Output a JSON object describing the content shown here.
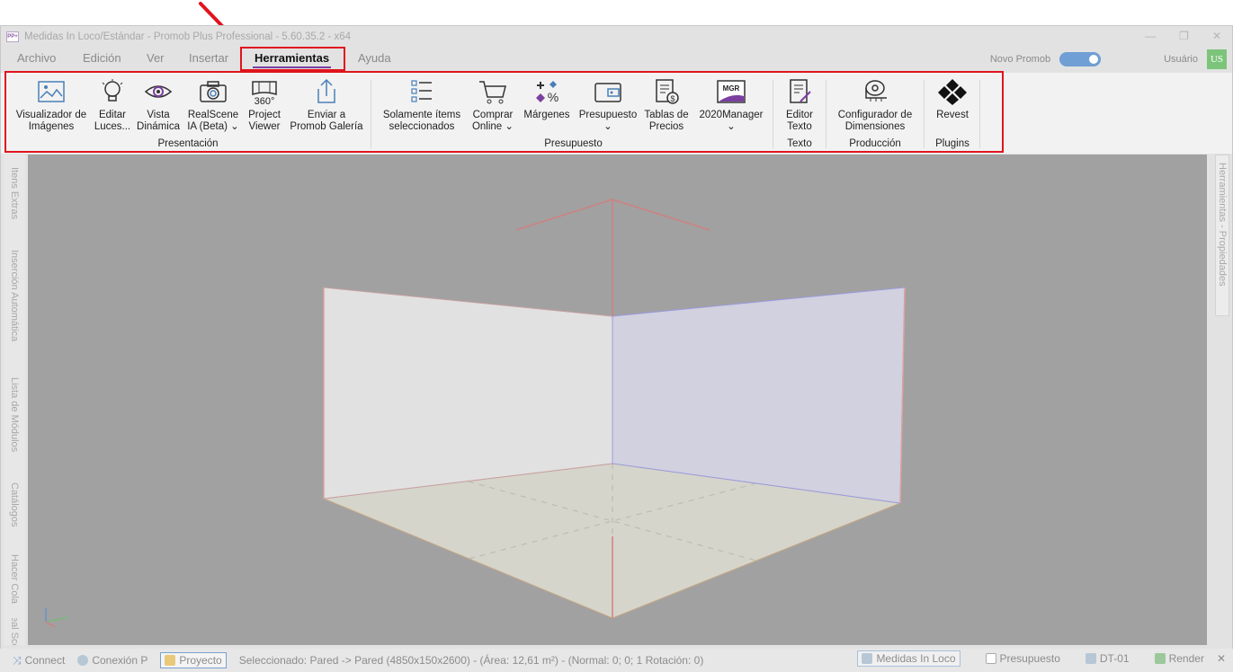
{
  "window": {
    "title": "Medidas In Loco/Estándar - Promob Plus Professional - 5.60.35.2 - x64",
    "logo_text": "PP+"
  },
  "menu": {
    "tabs": [
      "Archivo",
      "Edición",
      "Ver",
      "Insertar",
      "Herramientas",
      "Ayuda"
    ],
    "active_tab": "Herramientas",
    "toggle_label": "Novo Promob",
    "user_label": "Usuário",
    "user_initials": "US"
  },
  "ribbon": {
    "groups": {
      "presentacion": "Presentación",
      "presupuesto": "Presupuesto",
      "texto": "Texto",
      "produccion": "Producción",
      "plugins": "Plugins"
    },
    "buttons": {
      "visualizador": [
        "Visualizador de",
        "Imágenes"
      ],
      "editar_luces": [
        "Editar",
        "Luces..."
      ],
      "vista_dinamica": [
        "Vista",
        "Dinámica"
      ],
      "realscene": [
        "RealScene",
        "IA (Beta) ⌄"
      ],
      "project_viewer": [
        "Project",
        "Viewer"
      ],
      "enviar_galeria": [
        "Enviar a",
        "Promob Galería"
      ],
      "solamente_items": [
        "Solamente ítems",
        "seleccionados"
      ],
      "comprar_online": [
        "Comprar",
        "Online ⌄"
      ],
      "margenes": [
        "Márgenes",
        ""
      ],
      "presupuesto": [
        "Presupuesto",
        "⌄"
      ],
      "tablas_precios": [
        "Tablas de",
        "Precios"
      ],
      "manager_2020": [
        "2020Manager",
        "⌄"
      ],
      "editor_texto": [
        "Editor",
        "Texto"
      ],
      "configurador": [
        "Configurador de",
        "Dimensiones"
      ],
      "revest": [
        "Revest",
        ""
      ]
    },
    "icon_text": {
      "view360": "360°",
      "mgr": "MGR"
    }
  },
  "left_dock": [
    "Itens Extras",
    "Inserción Automática",
    "Lista de Módulos",
    "Catálogos",
    "Hacer Cola",
    "Real Scen"
  ],
  "right_dock": "Herramientas - Propiedades",
  "statusbar": {
    "connect": "Connect",
    "conexion": "Conexión P",
    "proyecto": "Proyecto",
    "selection": "Seleccionado: Pared -> Pared (4850x150x2600) - (Área: 12,61 m²) - (Normal: 0; 0; 1 Rotación: 0)",
    "medidas": "Medidas In Loco",
    "presupuesto": "Presupuesto",
    "dt": "DT-01",
    "render": "Render"
  },
  "colors": {
    "accent": "#7b3fa0",
    "annotation": "#e0141e",
    "viewport_bg": "#a1a1a1"
  }
}
